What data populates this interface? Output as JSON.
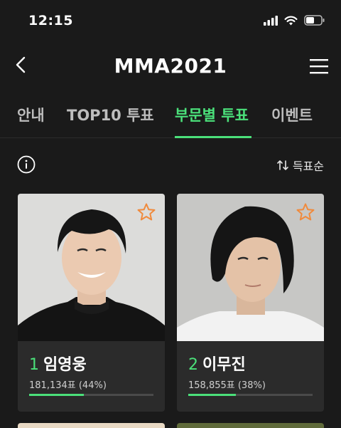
{
  "status": {
    "time": "12:15"
  },
  "header": {
    "title": "MMA2021"
  },
  "tabs": [
    {
      "label": "안내",
      "active": false
    },
    {
      "label": "TOP10 투표",
      "active": false
    },
    {
      "label": "부문별 투표",
      "active": true
    },
    {
      "label": "이벤트",
      "active": false
    }
  ],
  "toolbar": {
    "sort_label": "득표순"
  },
  "cards": [
    {
      "rank": "1",
      "name": "임영웅",
      "votes": "181,134표 (44%)",
      "share": 0.44
    },
    {
      "rank": "2",
      "name": "이무진",
      "votes": "158,855표 (38%)",
      "share": 0.38
    }
  ],
  "colors": {
    "accent": "#4be07a",
    "star": "#f08a3c",
    "background": "#1a1a1a",
    "card": "#2b2b2b"
  },
  "icons": [
    "back-arrow-icon",
    "menu-icon",
    "info-icon",
    "sort-icon",
    "star-icon",
    "signal-icon",
    "wifi-icon",
    "battery-icon"
  ]
}
